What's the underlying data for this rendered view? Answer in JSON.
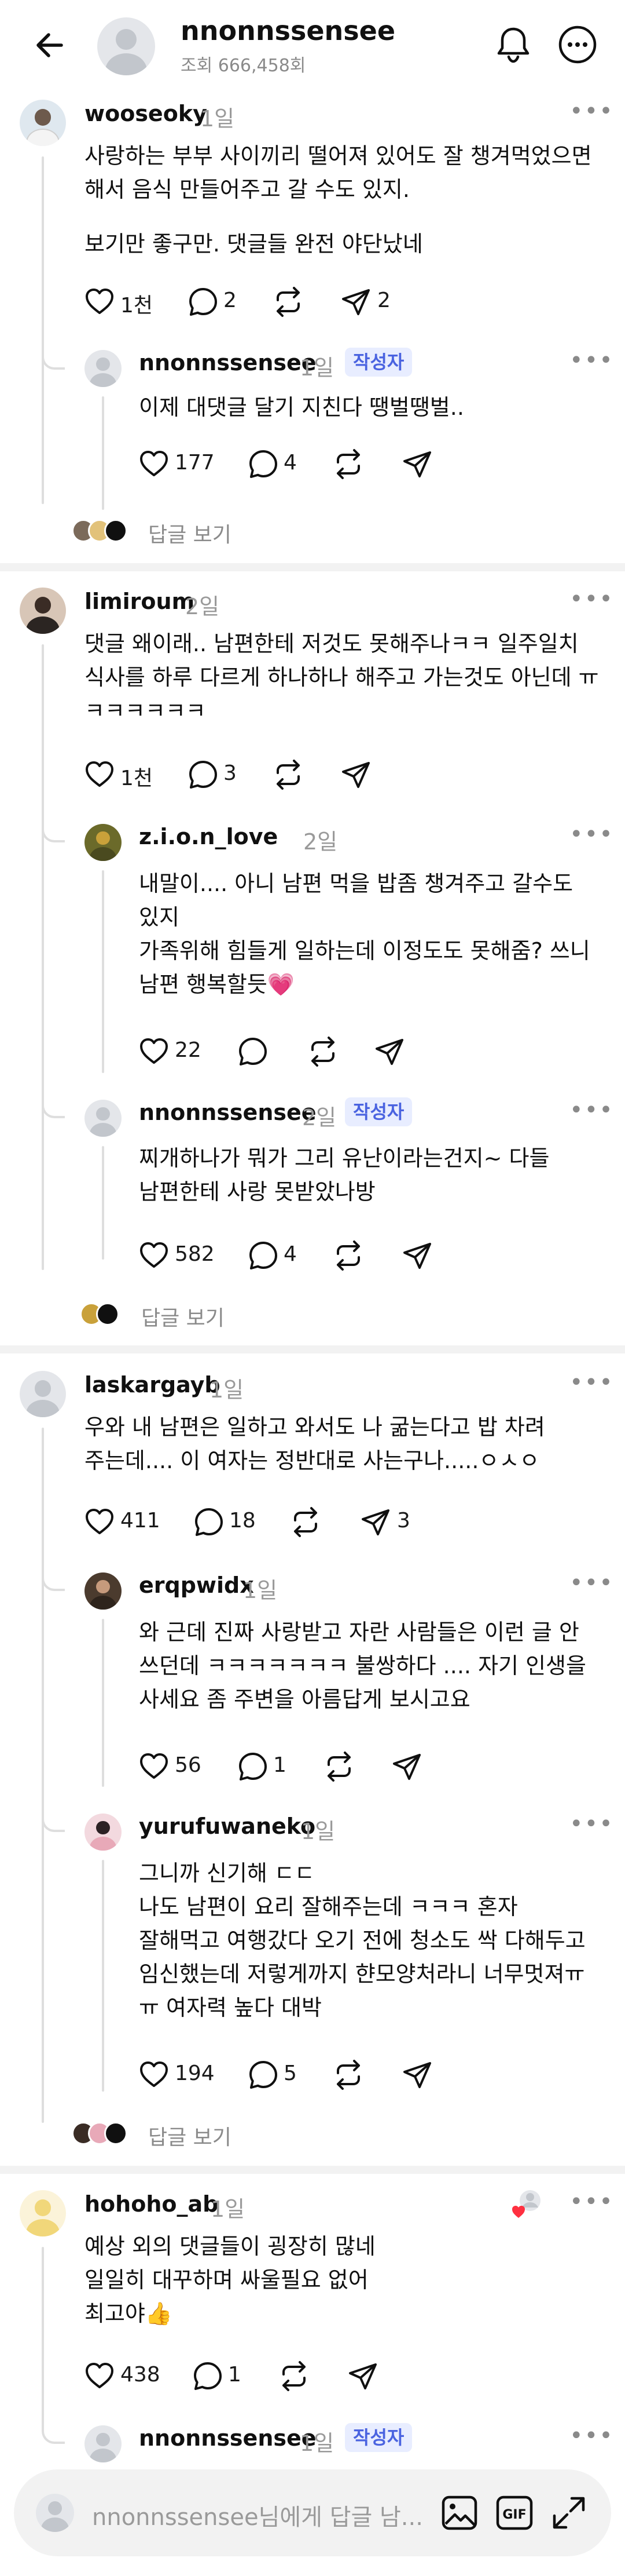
{
  "header": {
    "username": "nnonnssensee",
    "views": "조회 666,458회"
  },
  "comments": {
    "c1": {
      "username": "wooseoky",
      "time": "1일",
      "lines": [
        "사랑하는 부부 사이끼리 떨어져 있어도 잘 챙겨먹었으면",
        "해서 음식 만들어주고 갈 수도 있지.",
        "보기만 좋구만. 댓글들 완전 야단났네"
      ],
      "likes": "1천",
      "replies": "2",
      "shares": "2"
    },
    "r1": {
      "username": "nnonnssensee",
      "time": "1일",
      "badge": "작성자",
      "lines": [
        "이제 대댓글 달기 지친다 땡벌땡벌.."
      ],
      "likes": "177",
      "replies": "4"
    },
    "c1_view_replies": "답글 보기",
    "c2": {
      "username": "limiroum",
      "time": "2일",
      "lines": [
        "댓글 왜이래.. 남편한테 저것도 못해주나ㅋㅋ 일주일치",
        "식사를 하루 다르게 하나하나 해주고 가는것도 아닌데 ㅠ",
        "ㅋㅋㅋㅋㅋㅋ"
      ],
      "likes": "1천",
      "replies": "3"
    },
    "r2": {
      "username": "z.i.o.n_love",
      "time": "2일",
      "lines": [
        "내말이.... 아니 남편 먹을 밥좀 챙겨주고 갈수도",
        "있지",
        "가족위해 힘들게 일하는데 이정도도 못해줌? 쓰니",
        "남편 행복할듯💗"
      ],
      "likes": "22"
    },
    "r3": {
      "username": "nnonnssensee",
      "time": "2일",
      "badge": "작성자",
      "lines": [
        "찌개하나가 뭐가 그리 유난이라는건지~  다들",
        "남편한테 사랑 못받았나방"
      ],
      "likes": "582",
      "replies": "4"
    },
    "c2_view_replies": "답글 보기",
    "c3": {
      "username": "laskargayb",
      "time": "1일",
      "lines": [
        "우와 내 남편은 일하고 와서도 나 굶는다고 밥 차려",
        "주는데.... 이 여자는 정반대로 사는구나.....ㅇㅅㅇ"
      ],
      "likes": "411",
      "replies": "18",
      "shares": "3"
    },
    "r4": {
      "username": "erqpwidx",
      "time": "1일",
      "lines": [
        "와 근데 진짜 사랑받고 자란 사람들은 이런 글 안",
        "쓰던데 ㅋㅋㅋㅋㅋㅋㅋ 불쌍하다 .... 자기 인생을",
        "사세요 좀 주변을 아름답게 보시고요"
      ],
      "likes": "56",
      "replies": "1"
    },
    "r5": {
      "username": "yurufuwaneko",
      "time": "1일",
      "lines": [
        "그니까 신기해 ㄷㄷ",
        "나도 남편이 요리 잘해주는데 ㅋㅋㅋ 혼자",
        "잘해먹고 여행갔다 오기 전에 청소도 싹 다해두고",
        "임신했는데 저렇게까지 햔모양처라니 너무멋져ㅠ",
        "ㅠ 여자력 높다 대박"
      ],
      "likes": "194",
      "replies": "5"
    },
    "c3_view_replies": "답글 보기",
    "c4": {
      "username": "hohoho_ab",
      "time": "1일",
      "lines": [
        "예상 외의 댓글들이 굉장히 많네",
        "일일히 대꾸하며 싸울필요 없어",
        "최고야👍"
      ],
      "likes": "438",
      "replies": "1"
    },
    "r6": {
      "username": "nnonnssensee",
      "time": "1일",
      "badge": "작성자"
    }
  },
  "input": {
    "placeholder": "nnonnssensee님에게 답글 남..."
  },
  "colors": {
    "badge_bg": "#e8edff",
    "badge_text": "#4a63e0",
    "muted": "#9a9a9a",
    "heart_red": "#ff3040"
  }
}
